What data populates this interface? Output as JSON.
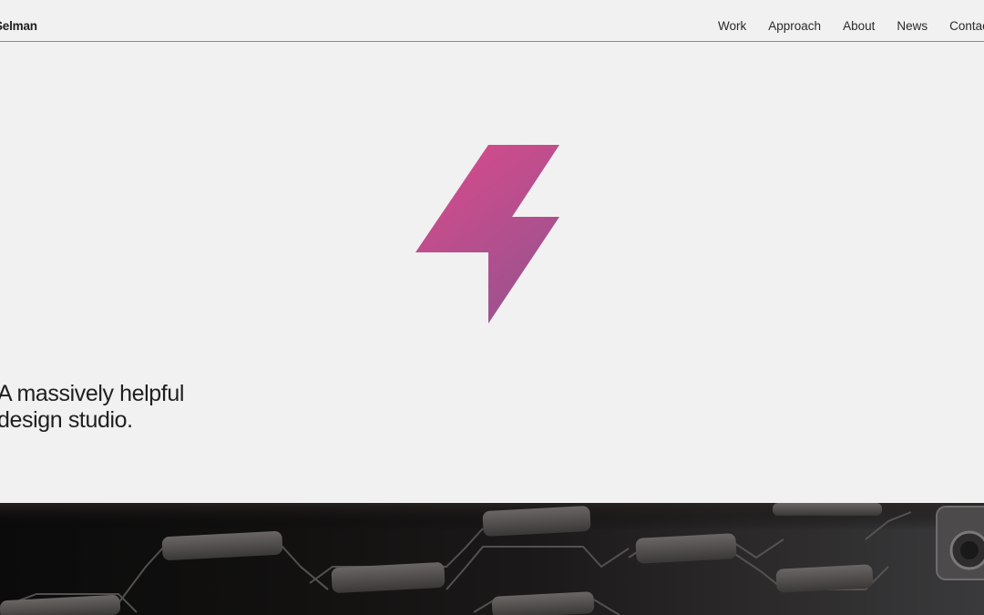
{
  "header": {
    "brand": "Selman",
    "nav": [
      {
        "label": "Work"
      },
      {
        "label": "Approach"
      },
      {
        "label": "About"
      },
      {
        "label": "News"
      },
      {
        "label": "Contact"
      }
    ]
  },
  "hero": {
    "tagline_line1": "A massively helpful",
    "tagline_line2": "design studio.",
    "logo_icon": "lightning-bolt-icon",
    "logo_colors": [
      "#d84a8c",
      "#a0538e"
    ]
  },
  "media": {
    "description_icon": "car-grille-image"
  }
}
